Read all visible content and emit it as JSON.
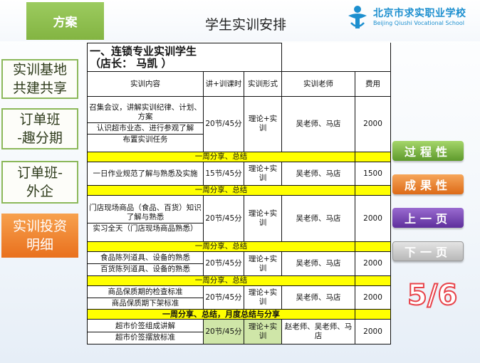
{
  "header": {
    "section_tab": "方案",
    "title": "学生实训安排",
    "logo_cn": "北京市求实职业学校",
    "logo_en": "Beijing Qiushi Vocational School"
  },
  "left_nav": [
    {
      "label": "实训基地\n共建共享"
    },
    {
      "label": "订单班\n-趣分期"
    },
    {
      "label": "订单班-\n外企"
    },
    {
      "label": "实训投资\n明细"
    }
  ],
  "table": {
    "title_line1": "一、连锁专业实训学生",
    "title_line2": "（店长：  马凯    ）",
    "headers": [
      "实训内容",
      "讲+训课时",
      "实训形式",
      "实训老师",
      "费用"
    ],
    "groups": [
      {
        "items": [
          "召集会议，讲解实训纪律、计划、方案",
          "认识超市业态、进行参观了解",
          "布置实训任务"
        ],
        "hours": "20节/45分",
        "form": "理论+实训",
        "teacher": "吴老师、马店",
        "fee": "2000"
      },
      {
        "summary": "一周分享、总结"
      },
      {
        "items": [
          "一日作业规范了解与熟悉及实施"
        ],
        "hours": "15节/45分",
        "form": "理论+实训",
        "teacher": "吴老师、马店",
        "fee": "1500"
      },
      {
        "summary": "一周分享、总结"
      },
      {
        "items": [
          "门店现场商品（食品、百货）知识了解与熟悉",
          "实习全天（门店现场商品熟悉）"
        ],
        "hours": "20节/45分",
        "form": "理论+实训",
        "teacher": "吴老师、马店",
        "fee": "2000"
      },
      {
        "summary": "一周分享、总结"
      },
      {
        "items": [
          "食品陈列道具、设备的熟悉",
          "百货陈列道具、设备的熟悉"
        ],
        "hours": "20节/45分",
        "form": "理论+实训",
        "teacher": "吴老师、马店",
        "fee": "2000"
      },
      {
        "summary": "一周分享、总结"
      },
      {
        "items": [
          "商品保质期的检查标准",
          "商品保质期下架标准"
        ],
        "hours": "20节/45分",
        "form": "理论+实训",
        "teacher": "吴老师、马店",
        "fee": "2000"
      },
      {
        "summary": "一周分享、总结，月度总结与分享",
        "strong": true
      },
      {
        "items": [
          "超市价签组成讲解",
          "超市价签摆放标准"
        ],
        "hours": "20节/45分",
        "form": "理论+实训",
        "teacher": "赵老师、吴老师、马店",
        "fee": "2000"
      }
    ]
  },
  "right_buttons": {
    "process": "过程性",
    "result": "成果性",
    "prev": "上一页",
    "next": "下一页"
  },
  "page_indicator": "5/6",
  "colors": {
    "green": "#83b442",
    "orange": "#e9701d",
    "purple": "#5e2f9c",
    "yellow": "#ffff00",
    "page_red": "#e8434a",
    "logo_blue": "#1c8fcf"
  }
}
